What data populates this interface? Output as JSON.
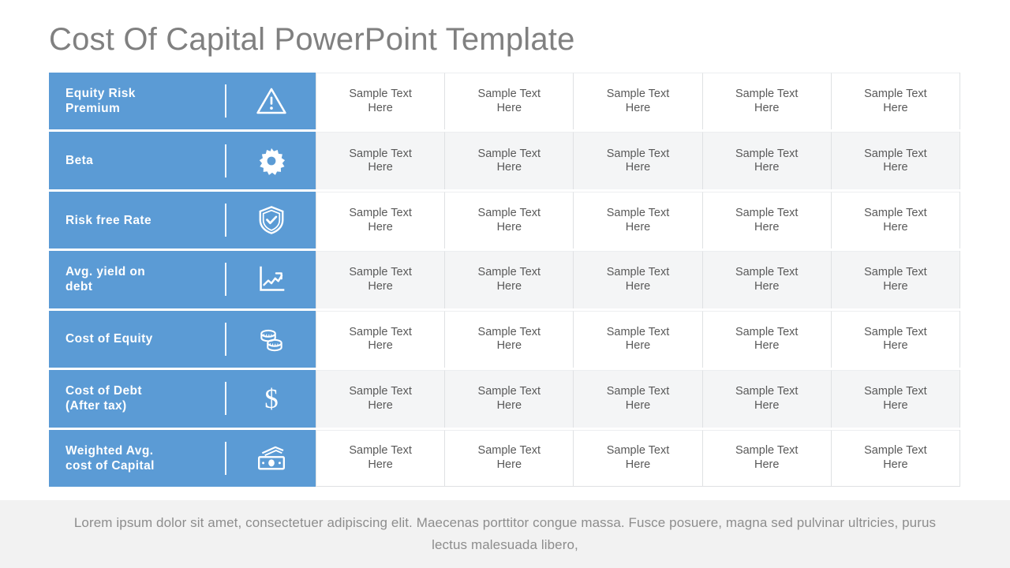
{
  "slide": {
    "title": "Cost Of Capital PowerPoint Template",
    "accent_color": "#5B9BD5",
    "title_color": "#808080",
    "background_color": "#FFFFFF",
    "footer_band_color": "#F2F2F2",
    "row_alt_color": "#F4F5F6"
  },
  "rows": [
    {
      "label": "Equity Risk\nPremium",
      "icon": "warning-triangle-icon"
    },
    {
      "label": "Beta",
      "icon": "gear-icon"
    },
    {
      "label": "Risk free Rate",
      "icon": "shield-check-icon"
    },
    {
      "label": "Avg. yield on\ndebt",
      "icon": "line-chart-icon"
    },
    {
      "label": "Cost of Equity",
      "icon": "coins-icon"
    },
    {
      "label": "Cost of Debt\n(After tax)",
      "icon": "dollar-sign-icon"
    },
    {
      "label": "Weighted Avg.\ncost of Capital",
      "icon": "banknote-icon"
    }
  ],
  "cells": [
    [
      "Sample Text\nHere",
      "Sample Text\nHere",
      "Sample Text\nHere",
      "Sample Text\nHere",
      "Sample Text\nHere"
    ],
    [
      "Sample Text\nHere",
      "Sample Text\nHere",
      "Sample Text\nHere",
      "Sample Text\nHere",
      "Sample Text\nHere"
    ],
    [
      "Sample Text\nHere",
      "Sample Text\nHere",
      "Sample Text\nHere",
      "Sample Text\nHere",
      "Sample Text\nHere"
    ],
    [
      "Sample Text\nHere",
      "Sample Text\nHere",
      "Sample Text\nHere",
      "Sample Text\nHere",
      "Sample Text\nHere"
    ],
    [
      "Sample Text\nHere",
      "Sample Text\nHere",
      "Sample Text\nHere",
      "Sample Text\nHere",
      "Sample Text\nHere"
    ],
    [
      "Sample Text\nHere",
      "Sample Text\nHere",
      "Sample Text\nHere",
      "Sample Text\nHere",
      "Sample Text\nHere"
    ],
    [
      "Sample Text\nHere",
      "Sample Text\nHere",
      "Sample Text\nHere",
      "Sample Text\nHere",
      "Sample Text\nHere"
    ]
  ],
  "footer": {
    "text": "Lorem ipsum dolor sit amet, consectetuer adipiscing elit. Maecenas porttitor congue massa. Fusce posuere, magna sed pulvinar ultricies, purus lectus malesuada libero,"
  }
}
